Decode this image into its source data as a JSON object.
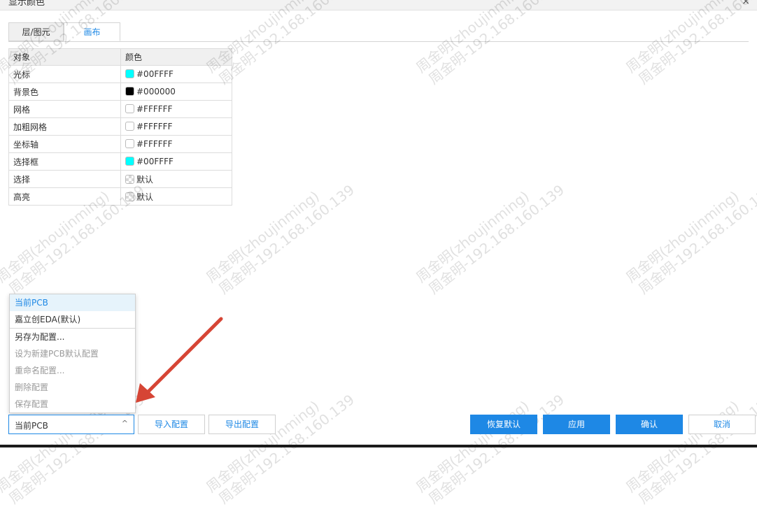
{
  "window": {
    "title": "显示颜色",
    "close_glyph": "×"
  },
  "tabs": [
    {
      "label": "层/图元",
      "active": false
    },
    {
      "label": "画布",
      "active": true
    }
  ],
  "table": {
    "headers": [
      "对象",
      "颜色"
    ],
    "rows": [
      {
        "object": "光标",
        "color": "#00FFFF",
        "swatch": "#00FFFF"
      },
      {
        "object": "背景色",
        "color": "#000000",
        "swatch": "#000000"
      },
      {
        "object": "网格",
        "color": "#FFFFFF",
        "swatch": "#FFFFFF"
      },
      {
        "object": "加粗网格",
        "color": "#FFFFFF",
        "swatch": "#FFFFFF"
      },
      {
        "object": "坐标轴",
        "color": "#FFFFFF",
        "swatch": "#FFFFFF"
      },
      {
        "object": "选择框",
        "color": "#00FFFF",
        "swatch": "#00FFFF"
      },
      {
        "object": "选择",
        "color": "默认",
        "swatch": "default"
      },
      {
        "object": "高亮",
        "color": "默认",
        "swatch": "default"
      }
    ]
  },
  "dropdown": {
    "items": [
      {
        "label": "当前PCB",
        "state": "active"
      },
      {
        "label": "嘉立创EDA(默认)",
        "state": "normal"
      },
      {
        "label": "另存为配置...",
        "state": "normal"
      },
      {
        "label": "设为新建PCB默认配置",
        "state": "disabled"
      },
      {
        "label": "重命名配置...",
        "state": "disabled"
      },
      {
        "label": "删除配置",
        "state": "disabled"
      },
      {
        "label": "保存配置",
        "state": "disabled"
      }
    ]
  },
  "footer": {
    "select_value": "当前PCB",
    "select_chevron": "^",
    "import_label": "导入配置",
    "export_label": "导出配置",
    "reset_label": "恢复默认",
    "apply_label": "应用",
    "confirm_label": "确认",
    "cancel_label": "取消"
  },
  "watermark": {
    "line1": "周金明(zhoujinming)",
    "line2": "周金明-192.168.160.139"
  },
  "colors": {
    "accent": "#1e88e5",
    "arrow": "#d64535"
  }
}
